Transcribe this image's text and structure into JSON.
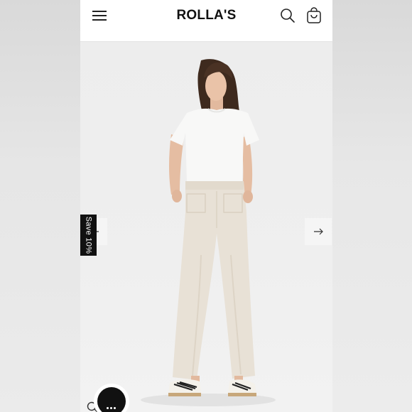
{
  "header": {
    "brand": "ROLLA'S",
    "menu_icon": "hamburger-menu-icon",
    "search_icon": "search-icon",
    "cart_icon": "shopping-bag-icon"
  },
  "gallery": {
    "image": "model-white-tee-cream-wide-leg-pants",
    "next_icon": "arrow-right-icon",
    "prev_icon": "arrow-left-icon"
  },
  "promo": {
    "save_label": "Save 10%"
  },
  "floating": {
    "search_icon": "search-icon",
    "chat_icon": "chat-bubble-icon"
  },
  "colors": {
    "header_bg": "#ffffff",
    "promo_bg": "#111111",
    "pants": "#e8e1d6",
    "tee": "#f7f7f6"
  }
}
